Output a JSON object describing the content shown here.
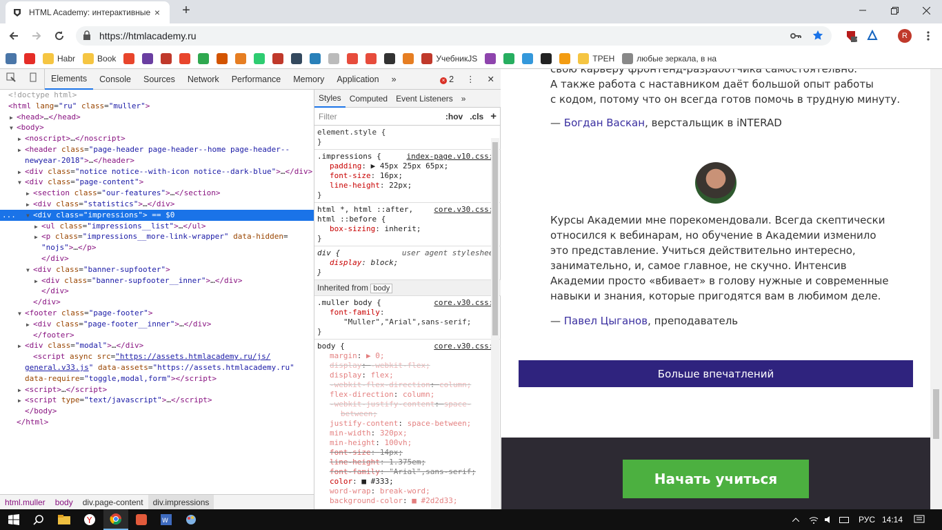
{
  "browser": {
    "tab_title": "HTML Academy: интерактивные",
    "tab_close": "×",
    "new_tab": "+",
    "url": "https://htmlacademy.ru",
    "profile_initial": "R",
    "ext_badge": "3",
    "bookmarks": [
      {
        "label": "",
        "color": "#4a76a8"
      },
      {
        "label": "",
        "color": "#e52d27"
      },
      {
        "label": "Habr",
        "color": "#f5c542"
      },
      {
        "label": "Book",
        "color": "#f5c542"
      },
      {
        "label": "",
        "color": "#e8452c"
      },
      {
        "label": "",
        "color": "#6a3ea1"
      },
      {
        "label": "",
        "color": "#c0392b"
      },
      {
        "label": "",
        "color": "#e8452c"
      },
      {
        "label": "",
        "color": "#2fa84f"
      },
      {
        "label": "",
        "color": "#d35400"
      },
      {
        "label": "",
        "color": "#e67e22"
      },
      {
        "label": "",
        "color": "#2ecc71"
      },
      {
        "label": "",
        "color": "#c0392b"
      },
      {
        "label": "",
        "color": "#34495e"
      },
      {
        "label": "",
        "color": "#2980b9"
      },
      {
        "label": "",
        "color": "#bbbbbb"
      },
      {
        "label": "",
        "color": "#e74c3c"
      },
      {
        "label": "",
        "color": "#e74c3c"
      },
      {
        "label": "",
        "color": "#333333"
      },
      {
        "label": "",
        "color": "#e67e22"
      },
      {
        "label": "УчебникJS",
        "color": "#c0392b"
      },
      {
        "label": "",
        "color": "#8e44ad"
      },
      {
        "label": "",
        "color": "#27ae60"
      },
      {
        "label": "",
        "color": "#3498db"
      },
      {
        "label": "",
        "color": "#222222"
      },
      {
        "label": "",
        "color": "#f39c12"
      },
      {
        "label": "ТРЕН",
        "color": "#f5c542"
      },
      {
        "label": "любые зеркала, в на",
        "color": "#888888"
      }
    ]
  },
  "devtools": {
    "tabs": [
      "Elements",
      "Console",
      "Sources",
      "Network",
      "Performance",
      "Memory",
      "Application"
    ],
    "more_tabs": "»",
    "error_count": "2",
    "close": "✕",
    "dom": [
      {
        "i": 0,
        "html": "<span class='cm'>&lt;!doctype html&gt;</span>"
      },
      {
        "i": 0,
        "html": "<span class='tg'>&lt;html</span> <span class='at'>lang</span>=<span class='av'>\"ru\"</span> <span class='at'>class</span>=<span class='av'>\"muller\"</span><span class='tg'>&gt;</span>"
      },
      {
        "i": 1,
        "a": "▶",
        "html": "<span class='tg'>&lt;head&gt;</span>…<span class='tg'>&lt;/head&gt;</span>"
      },
      {
        "i": 1,
        "a": "▼",
        "html": "<span class='tg'>&lt;body&gt;</span>"
      },
      {
        "i": 2,
        "a": "▶",
        "html": "<span class='tg'>&lt;noscript&gt;</span>…<span class='tg'>&lt;/noscript&gt;</span>"
      },
      {
        "i": 2,
        "a": "▶",
        "html": "<span class='tg'>&lt;header</span> <span class='at'>class</span>=<span class='av'>\"page-header page-header--home page-header--</span>"
      },
      {
        "i": 2,
        "html": "<span class='av'>newyear-2018\"</span><span class='tg'>&gt;</span>…<span class='tg'>&lt;/header&gt;</span>"
      },
      {
        "i": 2,
        "a": "▶",
        "html": "<span class='tg'>&lt;div</span> <span class='at'>class</span>=<span class='av'>\"notice notice--with-icon notice--dark-blue\"</span><span class='tg'>&gt;</span>…<span class='tg'>&lt;/div&gt;</span>"
      },
      {
        "i": 2,
        "a": "▼",
        "html": "<span class='tg'>&lt;div</span> <span class='at'>class</span>=<span class='av'>\"page-content\"</span><span class='tg'>&gt;</span>"
      },
      {
        "i": 3,
        "a": "▶",
        "html": "<span class='tg'>&lt;section</span> <span class='at'>class</span>=<span class='av'>\"our-features\"</span><span class='tg'>&gt;</span>…<span class='tg'>&lt;/section&gt;</span>"
      },
      {
        "i": 3,
        "a": "▶",
        "html": "<span class='tg'>&lt;div</span> <span class='at'>class</span>=<span class='av'>\"statistics\"</span><span class='tg'>&gt;</span>…<span class='tg'>&lt;/div&gt;</span>"
      },
      {
        "i": 3,
        "a": "▼",
        "sel": true,
        "html": "<span class='tg'>&lt;div</span> <span class='at'>class</span>=<span class='av'>\"impressions\"</span><span class='tg'>&gt;</span> == $0"
      },
      {
        "i": 4,
        "a": "▶",
        "html": "<span class='tg'>&lt;ul</span> <span class='at'>class</span>=<span class='av'>\"impressions__list\"</span><span class='tg'>&gt;</span>…<span class='tg'>&lt;/ul&gt;</span>"
      },
      {
        "i": 4,
        "a": "▶",
        "html": "<span class='tg'>&lt;p</span> <span class='at'>class</span>=<span class='av'>\"impressions__more-link-wrapper\"</span> <span class='at'>data-hidden</span>="
      },
      {
        "i": 4,
        "html": "<span class='av'>\"nojs\"</span><span class='tg'>&gt;</span>…<span class='tg'>&lt;/p&gt;</span>"
      },
      {
        "i": 4,
        "html": "<span class='tg'>&lt;/div&gt;</span>"
      },
      {
        "i": 3,
        "a": "▼",
        "html": "<span class='tg'>&lt;div</span> <span class='at'>class</span>=<span class='av'>\"banner-supfooter\"</span><span class='tg'>&gt;</span>"
      },
      {
        "i": 4,
        "a": "▶",
        "html": "<span class='tg'>&lt;div</span> <span class='at'>class</span>=<span class='av'>\"banner-supfooter__inner\"</span><span class='tg'>&gt;</span>…<span class='tg'>&lt;/div&gt;</span>"
      },
      {
        "i": 4,
        "html": "<span class='tg'>&lt;/div&gt;</span>"
      },
      {
        "i": 3,
        "html": "<span class='tg'>&lt;/div&gt;</span>"
      },
      {
        "i": 2,
        "a": "▼",
        "html": "<span class='tg'>&lt;footer</span> <span class='at'>class</span>=<span class='av'>\"page-footer\"</span><span class='tg'>&gt;</span>"
      },
      {
        "i": 3,
        "a": "▶",
        "html": "<span class='tg'>&lt;div</span> <span class='at'>class</span>=<span class='av'>\"page-footer__inner\"</span><span class='tg'>&gt;</span>…<span class='tg'>&lt;/div&gt;</span>"
      },
      {
        "i": 3,
        "html": "<span class='tg'>&lt;/footer&gt;</span>"
      },
      {
        "i": 2,
        "a": "▶",
        "html": "<span class='tg'>&lt;div</span> <span class='at'>class</span>=<span class='av'>\"modal\"</span><span class='tg'>&gt;</span>…<span class='tg'>&lt;/div&gt;</span>"
      },
      {
        "i": 3,
        "html": "<span class='tg'>&lt;script</span> <span class='at'>async</span> <span class='at'>src</span>=<span class='lk'>\"https://assets.htmlacademy.ru/js/</span>"
      },
      {
        "i": 2,
        "html": "<span class='lk'>general.v33.js</span><span class='av'>\"</span> <span class='at'>data-assets</span>=<span class='av'>\"https://assets.htmlacademy.ru\"</span>"
      },
      {
        "i": 2,
        "html": "<span class='at'>data-require</span>=<span class='av'>\"toggle,modal,form\"</span><span class='tg'>&gt;&lt;/script&gt;</span>"
      },
      {
        "i": 2,
        "a": "▶",
        "html": "<span class='tg'>&lt;script&gt;</span>…<span class='tg'>&lt;/script&gt;</span>"
      },
      {
        "i": 2,
        "a": "▶",
        "html": "<span class='tg'>&lt;script</span> <span class='at'>type</span>=<span class='av'>\"text/javascript\"</span><span class='tg'>&gt;</span>…<span class='tg'>&lt;/script&gt;</span>"
      },
      {
        "i": 2,
        "html": "<span class='tg'>&lt;/body&gt;</span>"
      },
      {
        "i": 1,
        "html": "<span class='tg'>&lt;/html&gt;</span>"
      }
    ],
    "breadcrumb": [
      "html.muller",
      "body",
      "div.page-content",
      "div.impressions"
    ],
    "styles": {
      "tabs": [
        "Styles",
        "Computed",
        "Event Listeners"
      ],
      "filter_placeholder": "Filter",
      "hov": ":hov",
      "cls": ".cls",
      "add": "+",
      "element_style": "element.style {",
      "close_brace": "}",
      "impressions_selector": ".impressions {",
      "impressions_source": "index-page.v10.css:1",
      "impressions_props": [
        {
          "n": "padding",
          "v": "▶ 45px 25px 65px;"
        },
        {
          "n": "font-size",
          "v": "16px;"
        },
        {
          "n": "line-height",
          "v": "22px;"
        }
      ],
      "html_selector_1": "html *, html ::after,",
      "html_selector_2": "html ::before {",
      "html_source": "core.v30.css:1",
      "html_props": [
        {
          "n": "box-sizing",
          "v": "inherit;"
        }
      ],
      "div_selector": "div {",
      "div_source": "user agent stylesheet",
      "div_props": [
        {
          "n": "display",
          "v": "block;"
        }
      ],
      "inherited_label": "Inherited from",
      "inherited_from": "body",
      "muller_selector": ".muller body {",
      "muller_source": "core.v30.css:1",
      "muller_prop_name": "font-family",
      "muller_prop_value": "\"Muller\",\"Arial\",sans-serif;",
      "body_selector": "body {",
      "body_source": "core.v30.css:1",
      "body_props": [
        {
          "n": "margin",
          "v": "▶ 0;",
          "d": true
        },
        {
          "n": "display",
          "v": "-webkit-flex;",
          "d": true,
          "s": true
        },
        {
          "n": "display",
          "v": "flex;",
          "d": true
        },
        {
          "n": "-webkit-flex-direction",
          "v": "column;",
          "d": true,
          "s": true
        },
        {
          "n": "flex-direction",
          "v": "column;",
          "d": true
        },
        {
          "n": "-webkit-justify-content",
          "v": "space-",
          "d": true,
          "s": true
        },
        {
          "n": "",
          "v": "between;",
          "d": true,
          "s": true
        },
        {
          "n": "justify-content",
          "v": "space-between;",
          "d": true
        },
        {
          "n": "min-width",
          "v": "320px;",
          "d": true
        },
        {
          "n": "min-height",
          "v": "100vh;",
          "d": true
        },
        {
          "n": "font-size",
          "v": "14px;",
          "s": true
        },
        {
          "n": "line-height",
          "v": "1.375em;",
          "s": true
        },
        {
          "n": "font-family",
          "v": "\"Arial\",sans-serif;",
          "s": true
        },
        {
          "n": "color",
          "v": "■ #333;"
        },
        {
          "n": "word-wrap",
          "v": "break-word;",
          "d": true
        },
        {
          "n": "background-color",
          "v": "■ #2d2d33;",
          "d": true
        }
      ]
    }
  },
  "page": {
    "quote1_lines": [
      "свою карьеру фронтенд-разработчика самостоятельно.",
      "А также работа с наставником даёт большой опыт работы",
      "с кодом, потому что он всегда готов помочь в трудную минуту."
    ],
    "author1_dash": "— ",
    "author1_name": "Богдан Васкан",
    "author1_role": ", верстальщик в iNTERAD",
    "quote2_lines": [
      "Курсы Академии мне порекомендовали. Всегда скептически",
      "относился к вебинарам, но обучение в Академии изменило",
      "это представление. Учиться действительно интересно,",
      "занимательно, и, самое главное, не скучно. Интенсив",
      "Академии просто «вбивает» в голову нужные и современные",
      "навыки и знания, которые пригодятся вам в любимом деле."
    ],
    "author2_dash": "— ",
    "author2_name": "Павел Цыганов",
    "author2_role": ", преподаватель",
    "more_button": "Больше впечатлений",
    "start_button": "Начать учиться"
  },
  "taskbar": {
    "language": "РУС",
    "time": "14:14"
  },
  "colors": {
    "accent_purple": "#2f237e",
    "start_green": "#4cb040",
    "footer_dark": "#2d2a33",
    "link": "#3a2fa0"
  }
}
